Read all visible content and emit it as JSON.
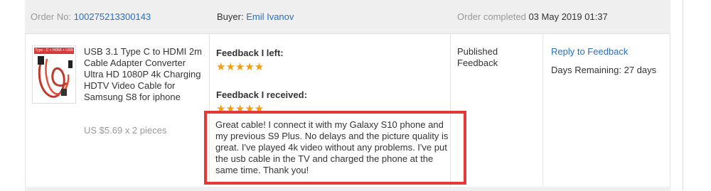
{
  "header": {
    "order_label": "Order No:",
    "order_number": "100275213300143",
    "buyer_label": "Buyer:",
    "buyer_name": "Emil Ivanov",
    "completed_label": "Order completed",
    "completed_date": "03 May 2019 01:37"
  },
  "product": {
    "thumbnail_caption": "Type - C + HDMI + USB",
    "title": "USB 3.1 Type C to HDMI 2m Cable Adapter Converter Ultra HD 1080P 4k Charging HDTV Video Cable for Samsung S8 for iphone",
    "price": "US $5.69 x 2 pieces"
  },
  "feedback": {
    "left_title": "Feedback I left:",
    "left_stars": "★★★★★",
    "left_rating": 5,
    "received_title": "Feedback I received:",
    "received_stars": "★★★★★",
    "received_rating": 5,
    "review_text": "Great cable! I connect it with my Galaxy S10 phone and my previous S9 Plus. No delays and the picture quality is great. I've played 4k video without any problems. I've put the usb cable in the TV and charged the phone at the same time. Thank you!"
  },
  "status": {
    "text": "Published Feedback"
  },
  "actions": {
    "reply_label": "Reply to Feedback",
    "days_remaining": "Days Remaining: 27 days"
  },
  "colors": {
    "link": "#2a6ebd",
    "star": "#f39c12",
    "highlight_box": "#e53935",
    "header_bg": "#efefef"
  }
}
